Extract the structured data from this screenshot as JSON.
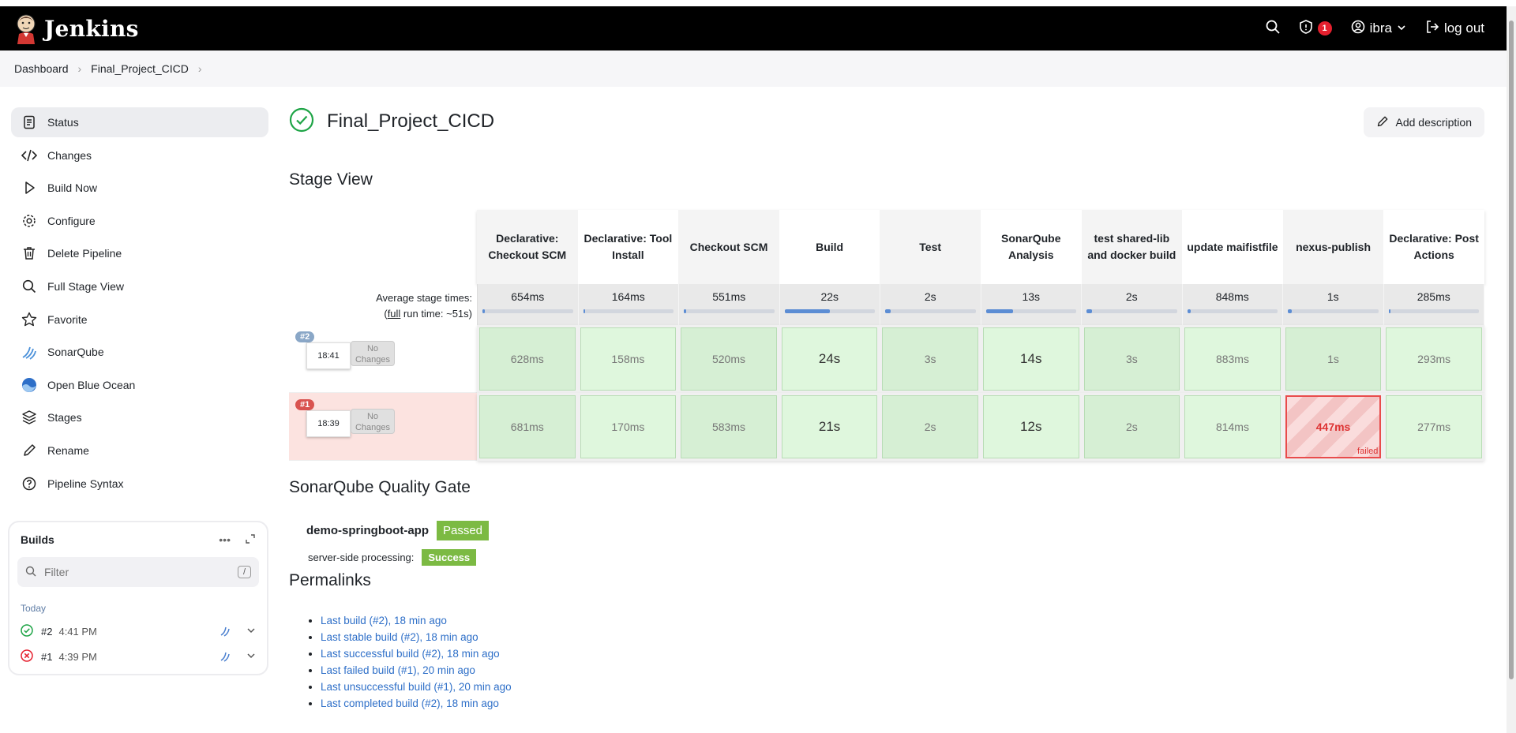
{
  "header": {
    "brand": "Jenkins",
    "security_count": "1",
    "user": "ibra",
    "logout": "log out"
  },
  "breadcrumbs": [
    "Dashboard",
    "Final_Project_CICD"
  ],
  "sidebar": {
    "items": [
      {
        "label": "Status",
        "icon": "status-icon"
      },
      {
        "label": "Changes",
        "icon": "code-icon"
      },
      {
        "label": "Build Now",
        "icon": "play-icon"
      },
      {
        "label": "Configure",
        "icon": "gear-icon"
      },
      {
        "label": "Delete Pipeline",
        "icon": "trash-icon"
      },
      {
        "label": "Full Stage View",
        "icon": "search-icon"
      },
      {
        "label": "Favorite",
        "icon": "star-icon"
      },
      {
        "label": "SonarQube",
        "icon": "sonarqube-icon"
      },
      {
        "label": "Open Blue Ocean",
        "icon": "blue-ocean-icon"
      },
      {
        "label": "Stages",
        "icon": "layers-icon"
      },
      {
        "label": "Rename",
        "icon": "pencil-icon"
      },
      {
        "label": "Pipeline Syntax",
        "icon": "help-icon"
      }
    ]
  },
  "builds": {
    "title": "Builds",
    "filter_placeholder": "Filter",
    "filter_shortcut": "/",
    "group": "Today",
    "items": [
      {
        "num": "#2",
        "time": "4:41 PM",
        "status": "success"
      },
      {
        "num": "#1",
        "time": "4:39 PM",
        "status": "failed"
      }
    ]
  },
  "main": {
    "title": "Final_Project_CICD",
    "add_description": "Add description",
    "stage_view_title": "Stage View",
    "avg_label_line1": "Average stage times:",
    "avg_label_full": "full",
    "avg_label_rest": " run time: ~51s)",
    "stages": [
      "Declarative: Checkout SCM",
      "Declarative: Tool Install",
      "Checkout SCM",
      "Build",
      "Test",
      "SonarQube Analysis",
      "test shared-lib and docker build",
      "update maifistfile",
      "nexus-publish",
      "Declarative: Post Actions"
    ],
    "averages": [
      "654ms",
      "164ms",
      "551ms",
      "22s",
      "2s",
      "13s",
      "2s",
      "848ms",
      "1s",
      "285ms"
    ],
    "average_fill": [
      0.03,
      0.01,
      0.03,
      0.5,
      0.06,
      0.3,
      0.06,
      0.04,
      0.04,
      0.02
    ],
    "runs": [
      {
        "badge": "#2",
        "time": "18:41",
        "changes": "No Changes",
        "cells": [
          "628ms",
          "158ms",
          "520ms",
          "24s",
          "3s",
          "14s",
          "3s",
          "883ms",
          "1s",
          "293ms"
        ]
      },
      {
        "badge": "#1",
        "time": "18:39",
        "changes": "No Changes",
        "cells": [
          "681ms",
          "170ms",
          "583ms",
          "21s",
          "2s",
          "12s",
          "2s",
          "814ms",
          "447ms",
          "277ms"
        ],
        "failed_index": 8,
        "failed_label": "failed"
      }
    ],
    "sonar": {
      "title": "SonarQube Quality Gate",
      "project": "demo-springboot-app",
      "status": "Passed",
      "processing_label": "server-side processing:",
      "processing_status": "Success"
    },
    "permalinks_title": "Permalinks",
    "permalinks": [
      "Last build (#2), 18 min ago",
      "Last stable build (#2), 18 min ago",
      "Last successful build (#2), 18 min ago",
      "Last failed build (#1), 20 min ago",
      "Last unsuccessful build (#1), 20 min ago",
      "Last completed build (#2), 18 min ago"
    ]
  }
}
